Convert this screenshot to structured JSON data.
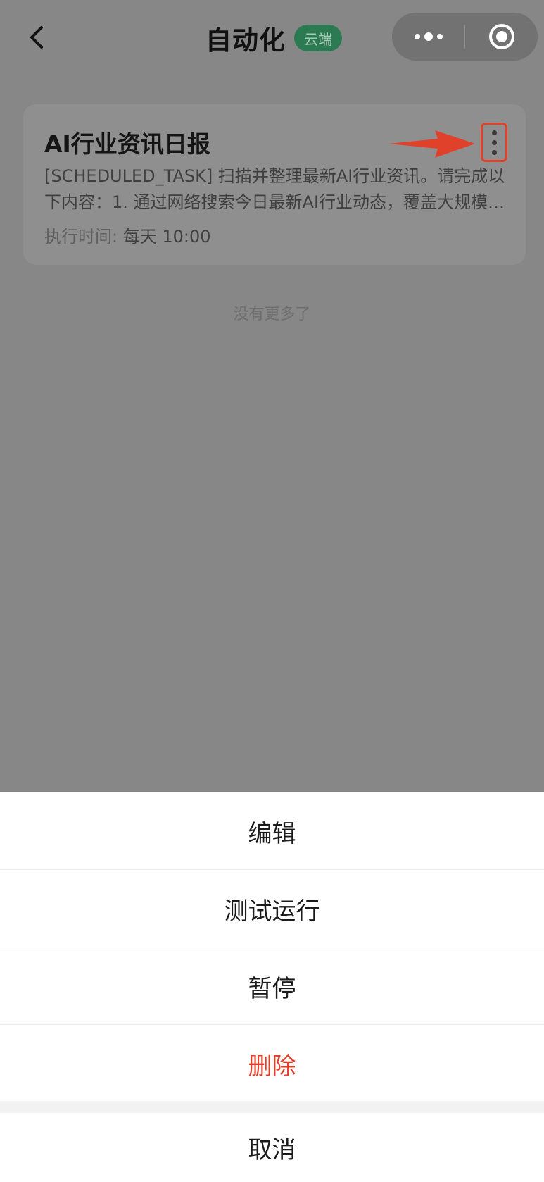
{
  "header": {
    "title": "自动化",
    "badge": "云端",
    "back_icon": "chevron-left-icon",
    "more_icon": "more-dots-icon",
    "close_icon": "target-circle-icon"
  },
  "task": {
    "title": "AI行业资讯日报",
    "description": "[SCHEDULED_TASK] 扫描并整理最新AI行业资讯。请完成以下内容：1. 通过网络搜索今日最新AI行业动态，覆盖大规模语言模型、多模态模型等",
    "time_label": "执行时间:",
    "time_value": "每天 10:00",
    "menu_icon": "vertical-dots-icon"
  },
  "list": {
    "end_text": "没有更多了"
  },
  "action_sheet": {
    "edit": "编辑",
    "test_run": "测试运行",
    "pause": "暂停",
    "delete": "删除",
    "cancel": "取消"
  },
  "colors": {
    "overlay": "#878787",
    "badge": "#2c7a52",
    "danger": "#e0412b",
    "highlight": "#e0412b"
  }
}
